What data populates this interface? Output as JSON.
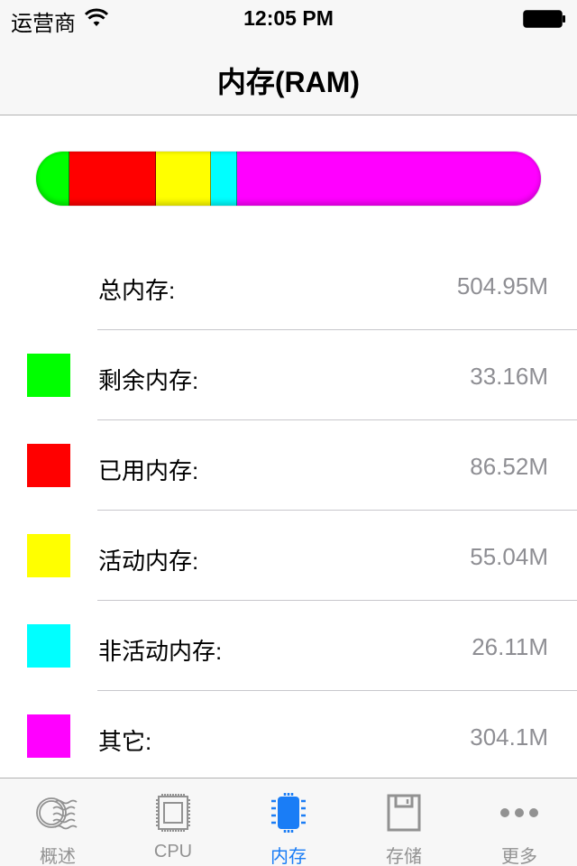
{
  "status_bar": {
    "carrier": "运营商",
    "time": "12:05 PM",
    "wifi_icon": "wifi-icon",
    "battery_icon": "battery-full-icon"
  },
  "nav": {
    "title": "内存(RAM)"
  },
  "memory": {
    "total": {
      "label": "总内存:",
      "value": "504.95M"
    },
    "items": [
      {
        "key": "free",
        "label": "剩余内存:",
        "value": "33.16M",
        "megabytes": 33.16,
        "color": "#00ff00"
      },
      {
        "key": "used",
        "label": "已用内存:",
        "value": "86.52M",
        "megabytes": 86.52,
        "color": "#ff0000"
      },
      {
        "key": "active",
        "label": "活动内存:",
        "value": "55.04M",
        "megabytes": 55.04,
        "color": "#ffff00"
      },
      {
        "key": "inactive",
        "label": "非活动内存:",
        "value": "26.11M",
        "megabytes": 26.11,
        "color": "#00ffff"
      },
      {
        "key": "other",
        "label": "其它:",
        "value": "304.1M",
        "megabytes": 304.1,
        "color": "#ff00ff"
      }
    ]
  },
  "tabs": [
    {
      "label": "概述",
      "icon": "overview-stamp-icon",
      "active": false
    },
    {
      "label": "CPU",
      "icon": "cpu-chip-icon",
      "active": false
    },
    {
      "label": "内存",
      "icon": "memory-chip-icon",
      "active": true
    },
    {
      "label": "存储",
      "icon": "floppy-disk-icon",
      "active": false
    },
    {
      "label": "更多",
      "icon": "more-dots-icon",
      "active": false
    }
  ],
  "colors": {
    "accent": "#1a7df6",
    "tab_inactive": "#929292",
    "value_text": "#8e8e93",
    "bar_background": "#f7f7f7"
  }
}
